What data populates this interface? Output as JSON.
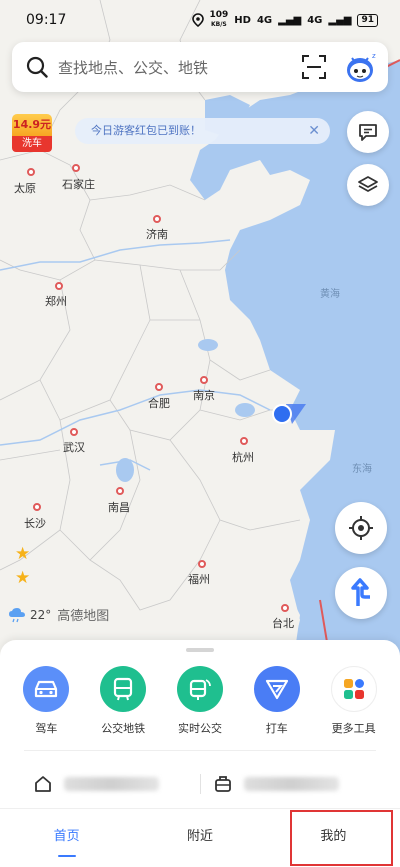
{
  "status_bar": {
    "time": "09:17",
    "net_speed_value": "109",
    "net_speed_unit": "KB/S",
    "hd_label": "HD",
    "signal_1": "4G",
    "signal_2": "4G",
    "battery": "91"
  },
  "search": {
    "placeholder": "查找地点、公交、地铁"
  },
  "promo": {
    "price": "14.9元",
    "label": "洗车"
  },
  "tip": {
    "text": "今日游客红包已到账！"
  },
  "map": {
    "cities": [
      "太原",
      "石家庄",
      "济南",
      "郑州",
      "合肥",
      "南京",
      "武汉",
      "杭州",
      "长沙",
      "南昌",
      "福州",
      "台北"
    ],
    "seas": [
      "黄海",
      "东海"
    ]
  },
  "weather": {
    "temperature": "22°",
    "logo": "高德地图"
  },
  "quick_actions": [
    {
      "label": "驾车",
      "icon": "car-icon",
      "color": "#5b8ff9"
    },
    {
      "label": "公交地铁",
      "icon": "bus-icon",
      "color": "#1fbf8f"
    },
    {
      "label": "实时公交",
      "icon": "realtime-bus-icon",
      "color": "#1fbf8f"
    },
    {
      "label": "打车",
      "icon": "taxi-icon",
      "color": "#4a7df5"
    },
    {
      "label": "更多工具",
      "icon": "more-tools-icon",
      "color": "#ffffff"
    }
  ],
  "tabs": [
    {
      "label": "首页",
      "active": true
    },
    {
      "label": "附近",
      "active": false
    },
    {
      "label": "我的",
      "active": false
    }
  ],
  "colors": {
    "accent": "#3a7afe",
    "sea": "#a8c8f0",
    "land": "#f3f2ee",
    "highlight": "#e03535"
  }
}
